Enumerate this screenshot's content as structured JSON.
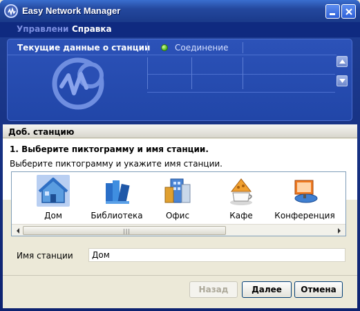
{
  "window": {
    "title": "Easy Network Manager"
  },
  "menu": {
    "items": [
      {
        "label": "Управлени"
      },
      {
        "label": "Справка"
      }
    ]
  },
  "status_panel": {
    "title": "Текущие данные о станции",
    "connection_label": "Соединение",
    "connection_status_color": "#48b218"
  },
  "wizard": {
    "section_title": "Доб. станцию",
    "step_title": "1. Выберите пиктограмму и имя станции.",
    "step_description": "Выберите пиктограмму и укажите имя станции.",
    "icons": [
      {
        "label": "Дом",
        "icon": "house-icon",
        "selected": true
      },
      {
        "label": "Библиотека",
        "icon": "library-icon",
        "selected": false
      },
      {
        "label": "Офис",
        "icon": "office-icon",
        "selected": false
      },
      {
        "label": "Кафе",
        "icon": "cafe-icon",
        "selected": false
      },
      {
        "label": "Конференция",
        "icon": "conference-icon",
        "selected": false
      }
    ],
    "station_name_label": "Имя станции",
    "station_name_value": "Дом",
    "buttons": {
      "back": "Назад",
      "next": "Далее",
      "cancel": "Отмена"
    }
  },
  "colors": {
    "title_bar": "#24489e",
    "panel_background": "#2146a8",
    "selection": "#b9cff2"
  }
}
